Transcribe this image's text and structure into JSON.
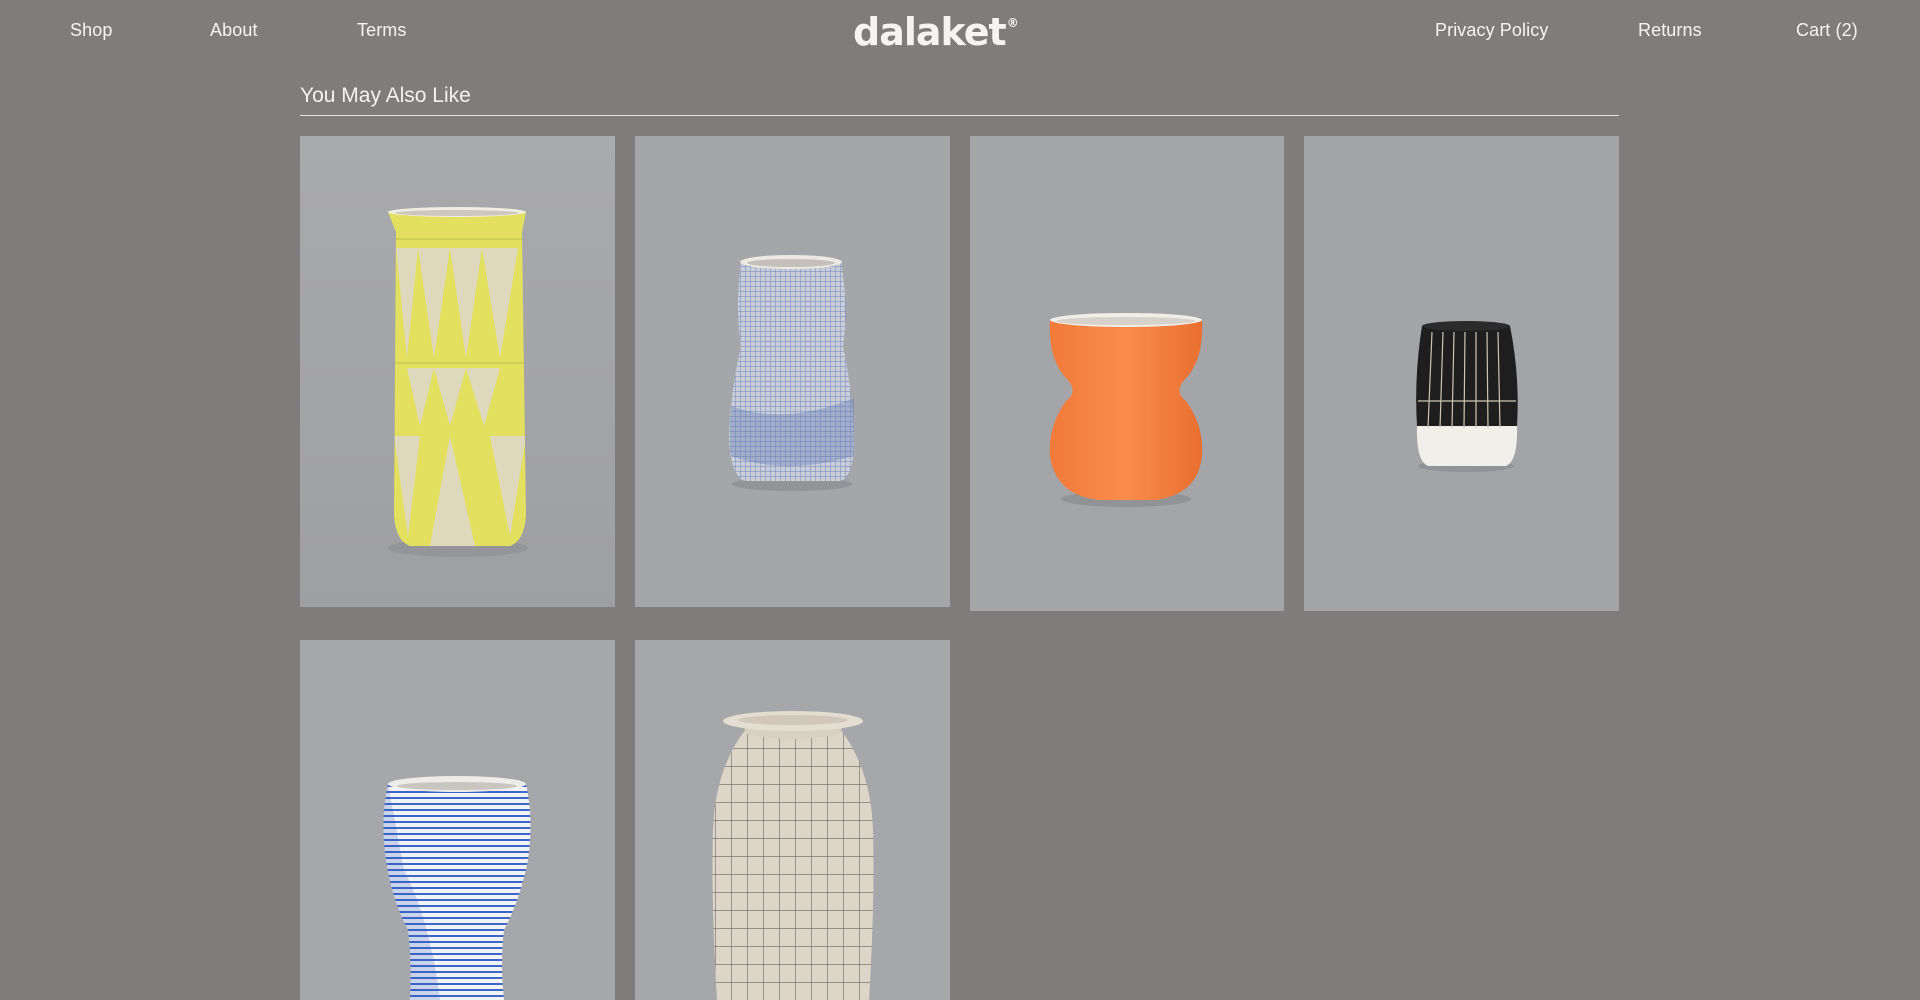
{
  "header": {
    "brand": "dalaket",
    "brand_mark": "®",
    "nav_left": [
      {
        "label": "Shop"
      },
      {
        "label": "About"
      },
      {
        "label": "Terms"
      }
    ],
    "nav_right": [
      {
        "label": "Privacy Policy"
      },
      {
        "label": "Returns"
      },
      {
        "label": "Cart (2)"
      }
    ]
  },
  "section": {
    "title": "You May Also Like"
  },
  "products": [
    {
      "image": "yellow-triangle-pattern-vase"
    },
    {
      "image": "blue-crosshatch-vase"
    },
    {
      "image": "orange-hourglass-vase"
    },
    {
      "image": "black-white-striped-cup"
    },
    {
      "image": "blue-striped-bulbous-vase"
    },
    {
      "image": "cream-grid-bottle-vase"
    }
  ],
  "colors": {
    "page_background": "#807c7b",
    "photo_background": "#a3a4a7",
    "text": "#f4f2f0"
  }
}
